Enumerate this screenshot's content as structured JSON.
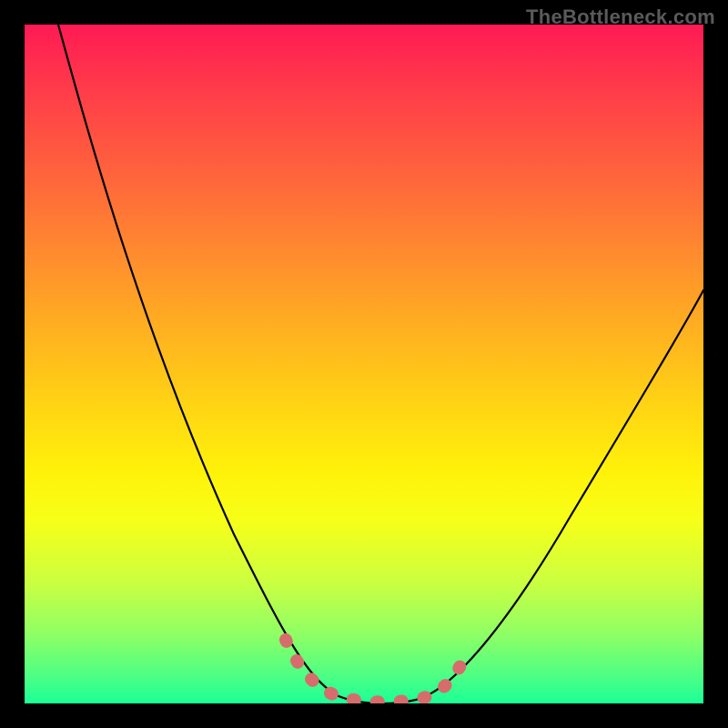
{
  "watermark": "TheBottleneck.com",
  "chart_data": {
    "type": "line",
    "title": "",
    "xlabel": "",
    "ylabel": "",
    "xlim": [
      0,
      100
    ],
    "ylim": [
      0,
      100
    ],
    "grid": false,
    "legend": false,
    "series": [
      {
        "name": "bottleneck-curve",
        "color": "#000000",
        "x": [
          5,
          10,
          15,
          20,
          25,
          30,
          35,
          40,
          42,
          45,
          48,
          52,
          55,
          58,
          62,
          68,
          75,
          82,
          90,
          98,
          100
        ],
        "y": [
          100,
          88,
          74,
          60,
          46,
          32,
          20,
          10,
          5,
          2,
          0,
          0,
          0,
          1,
          4,
          12,
          24,
          36,
          48,
          58,
          61
        ]
      },
      {
        "name": "optimal-band-dots",
        "color": "#d76c6c",
        "style": "dotted",
        "x": [
          40,
          42,
          44,
          45,
          47,
          49,
          51,
          53,
          55,
          57,
          59,
          60,
          62
        ],
        "y": [
          8,
          4,
          2,
          1,
          0,
          0,
          0,
          0,
          0,
          1,
          3,
          5,
          9
        ]
      }
    ],
    "background": "rainbow-gradient-red-to-green",
    "border": "#000000"
  }
}
